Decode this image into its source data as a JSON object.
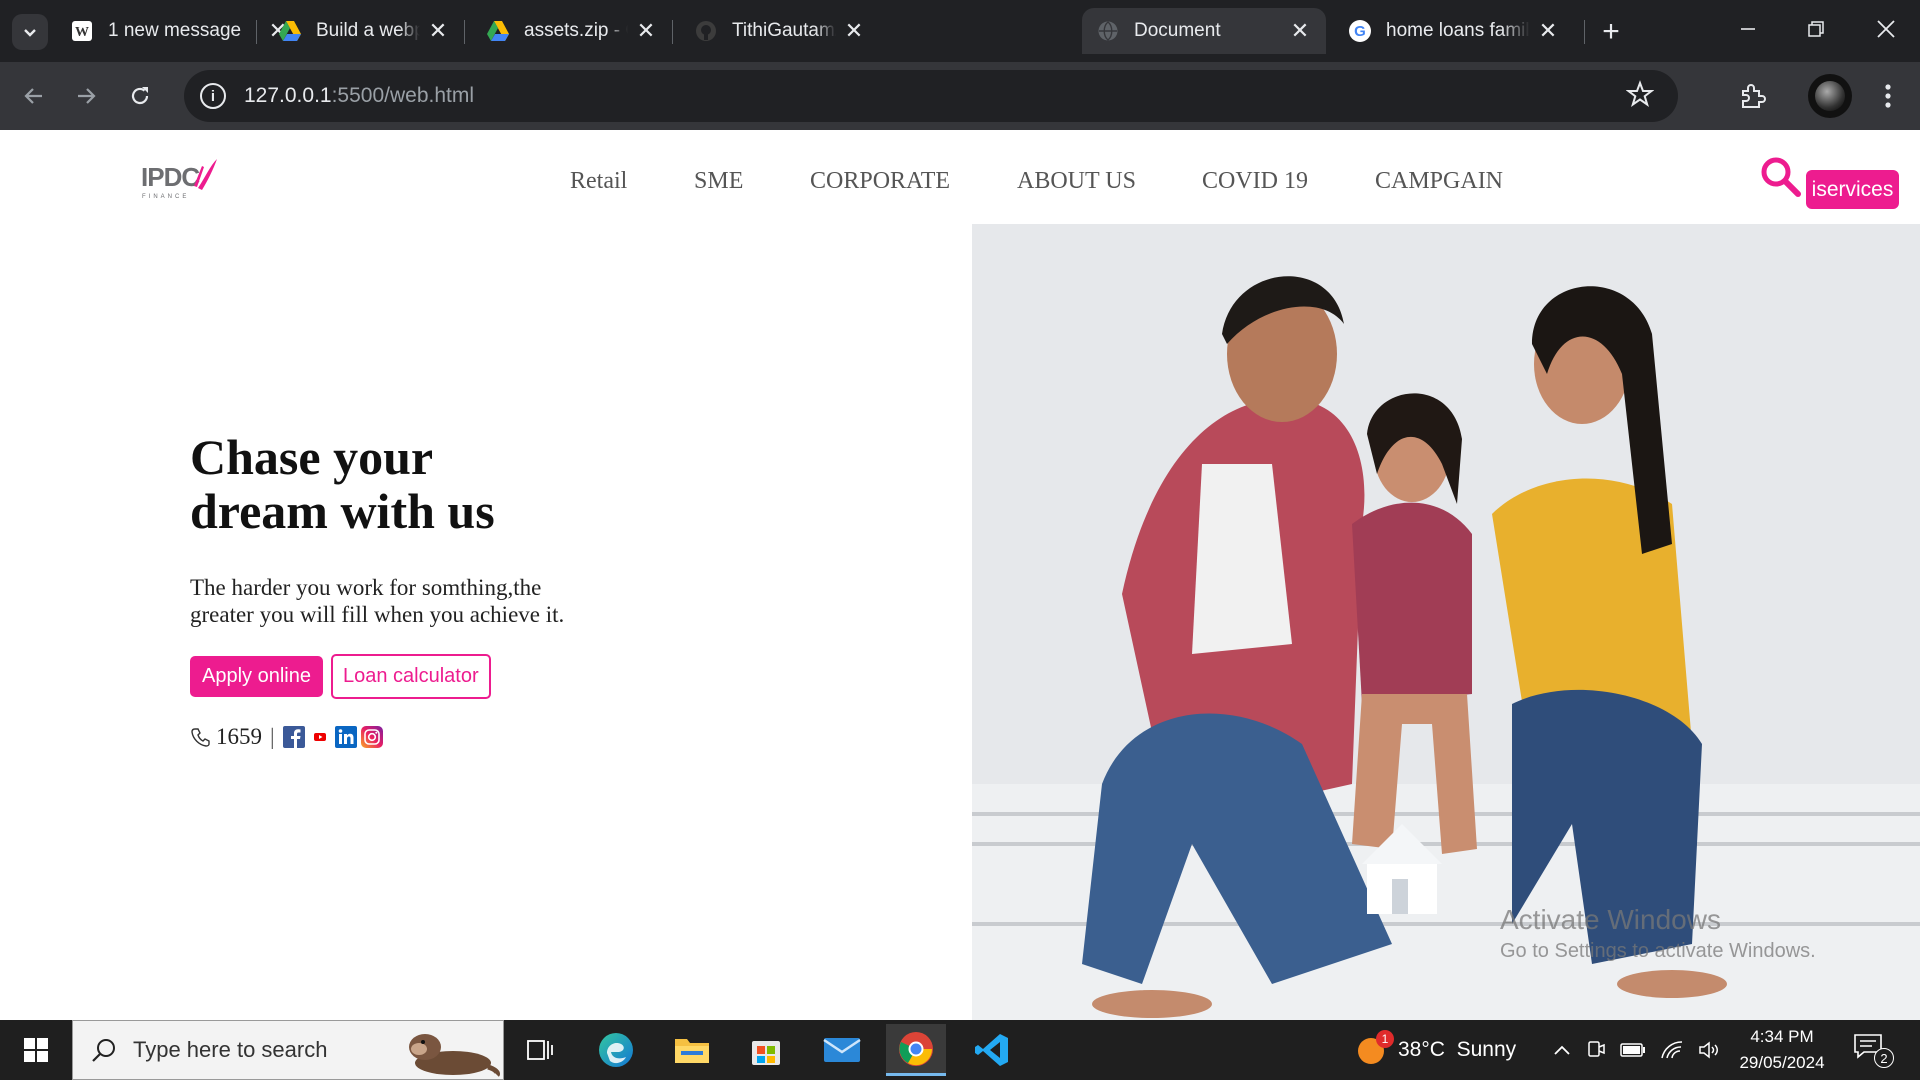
{
  "browser": {
    "tabs": [
      {
        "title": "1 new message",
        "favicon": "wordpress-icon",
        "active": false
      },
      {
        "title": "Build a webpage c",
        "favicon": "google-drive-icon",
        "active": false
      },
      {
        "title": "assets.zip - Google",
        "favicon": "google-drive-icon",
        "active": false
      },
      {
        "title": "TithiGautam/Async",
        "favicon": "github-icon",
        "active": false
      },
      {
        "title": "Document",
        "favicon": "globe-icon",
        "active": true
      },
      {
        "title": "home loans family",
        "favicon": "google-icon",
        "active": false
      }
    ],
    "url_host": "127.0.0.1",
    "url_path": ":5500/web.html"
  },
  "site": {
    "logo_text": "IPDC",
    "logo_sub": "FINANCE",
    "nav": [
      "Retail",
      "SME",
      "CORPORATE",
      "ABOUT US",
      "COVID 19",
      "CAMPGAIN"
    ],
    "iservices_label": "iservices",
    "headline_line1": "Chase your",
    "headline_line2": "dream with us",
    "subtext_line1": "The harder you work for somthing,the",
    "subtext_line2": "greater you will fill when you achieve it.",
    "apply_label": "Apply online",
    "loan_label": "Loan calculator",
    "phone": "1659",
    "separator": "|",
    "accent_color": "#ed1c8f"
  },
  "watermark": {
    "line1": "Activate Windows",
    "line2": "Go to Settings to activate Windows."
  },
  "taskbar": {
    "search_placeholder": "Type here to search",
    "weather_badge": "1",
    "weather": "38°C  Sunny",
    "time": "4:34 PM",
    "date": "29/05/2024",
    "notifications": "2"
  }
}
